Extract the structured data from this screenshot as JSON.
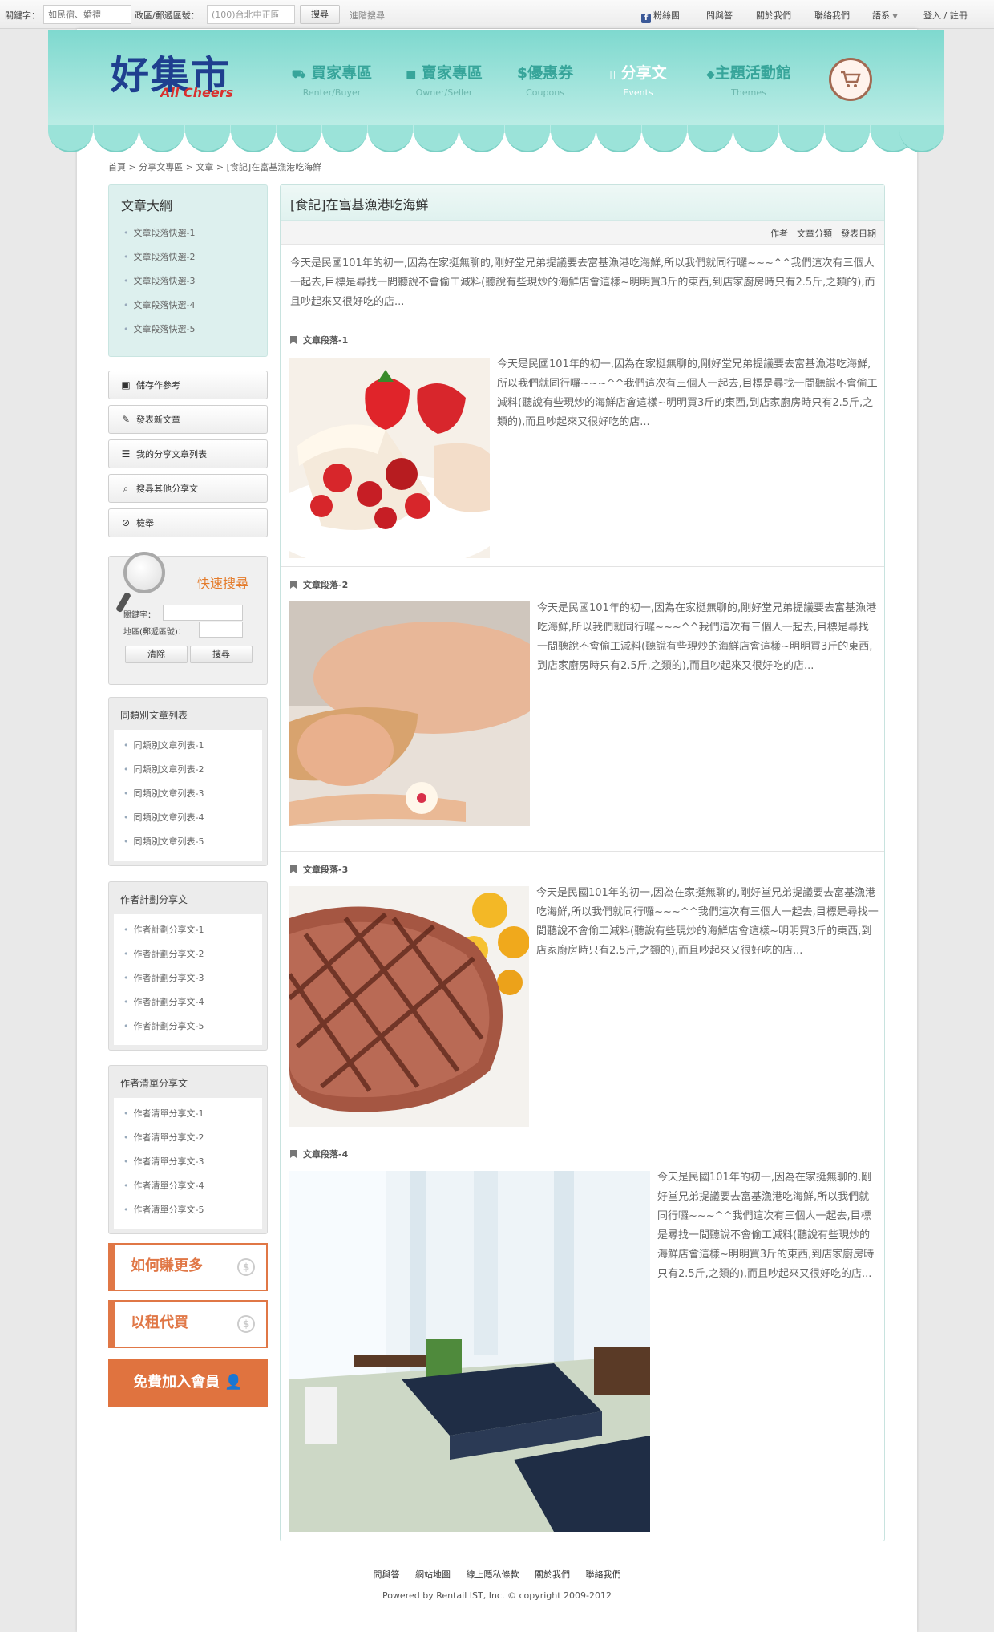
{
  "topbar": {
    "keyword_label": "關鍵字：",
    "keyword_placeholder": "如民宿、婚禮",
    "area_label": "政區/郵遞區號：",
    "area_value": "(100)台北中正區",
    "search_button": "搜尋",
    "advanced_link": "進階搜尋",
    "fans_link": "粉絲團",
    "faq_link": "問與答",
    "about_link": "關於我們",
    "contact_link": "聯絡我們",
    "language_link": "語系",
    "login_link": "登入 / 註冊"
  },
  "header": {
    "logo_text": "好集市",
    "logo_sub": "All Cheers",
    "nav": [
      {
        "label": "買家專區",
        "sub": "Renter/Buyer",
        "icon": "cart-icon"
      },
      {
        "label": "賣家專區",
        "sub": "Owner/Seller",
        "icon": "briefcase-icon"
      },
      {
        "label": "優惠券",
        "sub": "Coupons",
        "icon": "dollar-icon"
      },
      {
        "label": "分享文",
        "sub": "Events",
        "icon": "document-icon"
      },
      {
        "label": "主題活動館",
        "sub": "Themes",
        "icon": "tag-icon"
      }
    ]
  },
  "breadcrumb": "首頁 > 分享文專區 > 文章 > [食記]在富基漁港吃海鮮",
  "toc": {
    "title": "文章大綱",
    "items": [
      "文章段落快選-1",
      "文章段落快選-2",
      "文章段落快選-3",
      "文章段落快選-4",
      "文章段落快選-5"
    ]
  },
  "actions": [
    {
      "label": "儲存作參考",
      "icon": "save-icon"
    },
    {
      "label": "發表新文章",
      "icon": "pencil-icon"
    },
    {
      "label": "我的分享文章列表",
      "icon": "list-icon"
    },
    {
      "label": "搜尋其他分享文",
      "icon": "search-icon"
    },
    {
      "label": "檢舉",
      "icon": "ban-icon"
    }
  ],
  "quick_search": {
    "title": "快速搜尋",
    "keyword_label": "關鍵字：",
    "area_label": "地區(郵遞區號)：",
    "clear_button": "清除",
    "search_button": "搜尋"
  },
  "boxes": [
    {
      "title": "同類別文章列表",
      "items": [
        "同類別文章列表-1",
        "同類別文章列表-2",
        "同類別文章列表-3",
        "同類別文章列表-4",
        "同類別文章列表-5"
      ]
    },
    {
      "title": "作者計劃分享文",
      "items": [
        "作者計劃分享文-1",
        "作者計劃分享文-2",
        "作者計劃分享文-3",
        "作者計劃分享文-4",
        "作者計劃分享文-5"
      ]
    },
    {
      "title": "作者清單分享文",
      "items": [
        "作者清單分享文-1",
        "作者清單分享文-2",
        "作者清單分享文-3",
        "作者清單分享文-4",
        "作者清單分享文-5"
      ]
    }
  ],
  "promos": {
    "earn_more": "如何賺更多",
    "rent_instead": "以租代買",
    "join": "免費加入會員"
  },
  "article": {
    "title": "[食記]在富基漁港吃海鮮",
    "meta": "作者　文章分類　發表日期",
    "intro": "今天是民國101年的初一,因為在家挺無聊的,剛好堂兄弟提議要去富基漁港吃海鮮,所以我們就同行囉~~~^^我們這次有三個人一起去,目標是尋找一間聽說不會偷工減料(聽說有些現炒的海鮮店會這樣~明明買3斤的東西,到店家廚房時只有2.5斤,之類的),而且吵起來又很好吃的店...",
    "sections": [
      {
        "heading": "文章段落-1",
        "text": "今天是民國101年的初一,因為在家挺無聊的,剛好堂兄弟提議要去富基漁港吃海鮮,所以我們就同行囉~~~^^我們這次有三個人一起去,目標是尋找一間聽說不會偷工減料(聽說有些現炒的海鮮店會這樣~明明買3斤的東西,到店家廚房時只有2.5斤,之類的),而且吵起來又很好吃的店...",
        "image": "strawberry-dessert-photo"
      },
      {
        "heading": "文章段落-2",
        "text": "今天是民國101年的初一,因為在家挺無聊的,剛好堂兄弟提議要去富基漁港吃海鮮,所以我們就同行囉~~~^^我們這次有三個人一起去,目標是尋找一間聽說不會偷工減料(聽說有些現炒的海鮮店會這樣~明明買3斤的東西,到店家廚房時只有2.5斤,之類的),而且吵起來又很好吃的店...",
        "image": "spa-massage-photo"
      },
      {
        "heading": "文章段落-3",
        "text": "今天是民國101年的初一,因為在家挺無聊的,剛好堂兄弟提議要去富基漁港吃海鮮,所以我們就同行囉~~~^^我們這次有三個人一起去,目標是尋找一間聽說不會偷工減料(聽說有些現炒的海鮮店會這樣~明明買3斤的東西,到店家廚房時只有2.5斤,之類的),而且吵起來又很好吃的店...",
        "image": "grilled-steak-photo"
      },
      {
        "heading": "文章段落-4",
        "text": "今天是民國101年的初一,因為在家挺無聊的,剛好堂兄弟提議要去富基漁港吃海鮮,所以我們就同行囉~~~^^我們這次有三個人一起去,目標是尋找一間聽說不會偷工減料(聽說有些現炒的海鮮店會這樣~明明買3斤的東西,到店家廚房時只有2.5斤,之類的),而且吵起來又很好吃的店...",
        "image": "hotel-lounge-photo"
      }
    ]
  },
  "footer": {
    "links": [
      "問與答",
      "網站地圖",
      "線上隱私條款",
      "關於我們",
      "聯絡我們"
    ],
    "copyright": "Powered by Rentail IST, Inc. © copyright 2009-2012"
  },
  "colors": {
    "teal": "#7fd9cf",
    "orange": "#e07746",
    "navy": "#1f3f8f",
    "red": "#d9302e"
  }
}
